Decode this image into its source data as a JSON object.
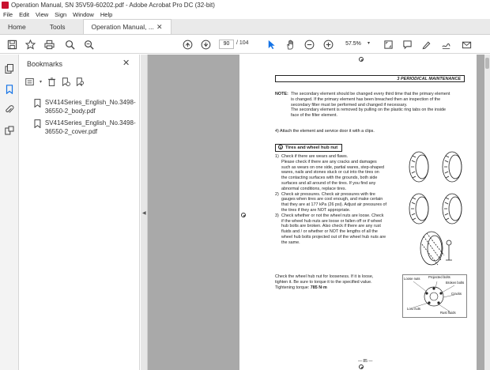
{
  "window": {
    "title": "Operation Manual, SN 35V59-60202.pdf - Adobe Acrobat Pro DC (32-bit)"
  },
  "menu": [
    "File",
    "Edit",
    "View",
    "Sign",
    "Window",
    "Help"
  ],
  "tabs": {
    "home": "Home",
    "tools": "Tools",
    "document": "Operation Manual, ..."
  },
  "toolbar": {
    "page_current": "90",
    "page_total": "/ 104",
    "zoom": "57.5%"
  },
  "bookmarks": {
    "title": "Bookmarks",
    "items": [
      {
        "label": "SV414Series_English_No.3498-36550-2_body.pdf"
      },
      {
        "label": "SV414Series_English_No.3498-36550-2_cover.pdf"
      }
    ]
  },
  "icons": {
    "left_rail": [
      "copy-pages-icon",
      "bookmark-icon",
      "attachment-icon",
      "layers-icon"
    ],
    "toolbar": [
      "save-icon",
      "star-icon",
      "print-icon",
      "search-icon",
      "prev-page-icon",
      "next-page-icon",
      "select-cursor-icon",
      "hand-tool-icon",
      "zoom-out-icon",
      "zoom-in-icon"
    ]
  },
  "document": {
    "section_header": "3  PERIODICAL MAINTENANCE",
    "note_label": "NOTE:",
    "note_lines": [
      "The secondary element should be changed every third time that the primary element",
      "is changed. If the primary element has been breached then an inspection of the",
      "secondary filter must be performed and changed if necessary.",
      "The secondary element is removed by pulling on the plastic ring tabs on the inside",
      "face of the filter element."
    ],
    "step4": "4) Attach the element and service door it with a clips.",
    "subsection_num": "5",
    "subsection_title": "Tires and wheel hub nut",
    "steps": [
      {
        "num": "1)",
        "lines": [
          "Check if there are wears and flaws.",
          "Please check if there are any cracks and damages",
          "such as wears on one side, partial wares, step-shaped",
          "wares, nails and stones stuck or cut into the tires on",
          "the contacting surfaces with the grounds, both side",
          "surfaces and all around of the tires. If you find any",
          "abnormal conditions, replace tires."
        ]
      },
      {
        "num": "2)",
        "lines": [
          "Check air pressures. Check air pressures with tire",
          "gauges when tires are cool enough, and make certain",
          "that they are at 177 kPa (26 psi). Adjust air pressures of",
          "the tires if they are NOT appropriate."
        ]
      },
      {
        "num": "3)",
        "lines": [
          "Check whether or not the wheel nuts are loose. Check",
          "if the wheel hub nuts are loose or fallen off or if wheel",
          "hub bolts are broken. Also check if there are any rust",
          "fluids and / or whether or NOT the lengths of all the",
          "wheel hub bolts projected out of the wheel hub nuts are",
          "the same."
        ]
      }
    ],
    "check_lines": [
      "Check the wheel hub nut for looseness. If it is loose,",
      "tighten it. Be sure to torque it to the specified value.",
      "Tightening torque: "
    ],
    "torque_value": "785 N·m",
    "diagram_labels": {
      "loose_nuts": "Loose nuts",
      "projected_bolts": "Projected bolts",
      "broken_bolts": "Broken bolts",
      "cracks": "Cracks",
      "lost_nuts": "Lost nuts",
      "rust_fluids": "Rust fluids"
    },
    "page_number": "— 85 —"
  }
}
